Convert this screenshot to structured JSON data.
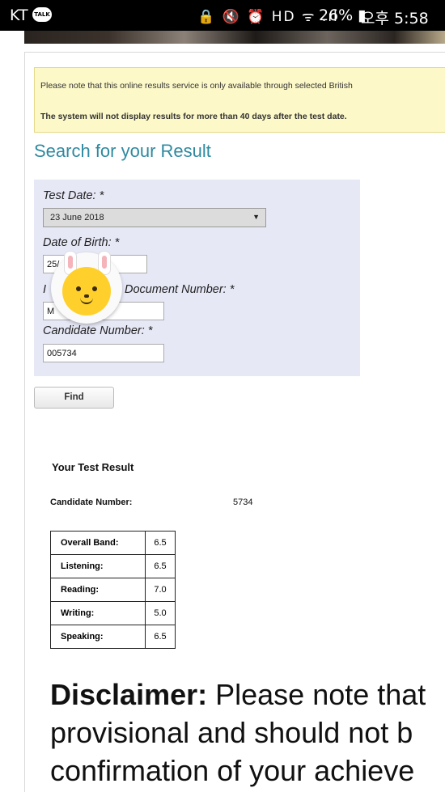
{
  "status_bar": {
    "carrier": "KT",
    "talk_badge": "TALK",
    "icons": "🔒 🔇 ⏰ HD ᯤ .ıl",
    "battery": "26% ▮",
    "time": "오후 5:58"
  },
  "notice": {
    "line1": "Please note that this online results service is only available through selected British",
    "line2": "The system will not display results for more than 40 days after the test date."
  },
  "search": {
    "title": "Search for your Result",
    "test_date_label": "Test Date: *",
    "test_date_value": "23 June 2018",
    "dob_label": "Date of Birth: *",
    "dob_value": "25/",
    "id_label_start": "I",
    "id_label_end": "Document Number: *",
    "id_value": "M",
    "candidate_label": "Candidate Number: *",
    "candidate_value": "005734",
    "find_label": "Find"
  },
  "result": {
    "title": "Your Test Result",
    "candidate_label": "Candidate Number:",
    "candidate_value": "5734",
    "scores": [
      {
        "label": "Overall Band:",
        "value": "6.5"
      },
      {
        "label": "Listening:",
        "value": "6.5"
      },
      {
        "label": "Reading:",
        "value": "7.0"
      },
      {
        "label": "Writing:",
        "value": "5.0"
      },
      {
        "label": "Speaking:",
        "value": "6.5"
      }
    ]
  },
  "disclaimer": {
    "heading": "Disclaimer:",
    "line1": " Please note that",
    "line2": "provisional and should not b",
    "line3": "confirmation of your achieve"
  }
}
